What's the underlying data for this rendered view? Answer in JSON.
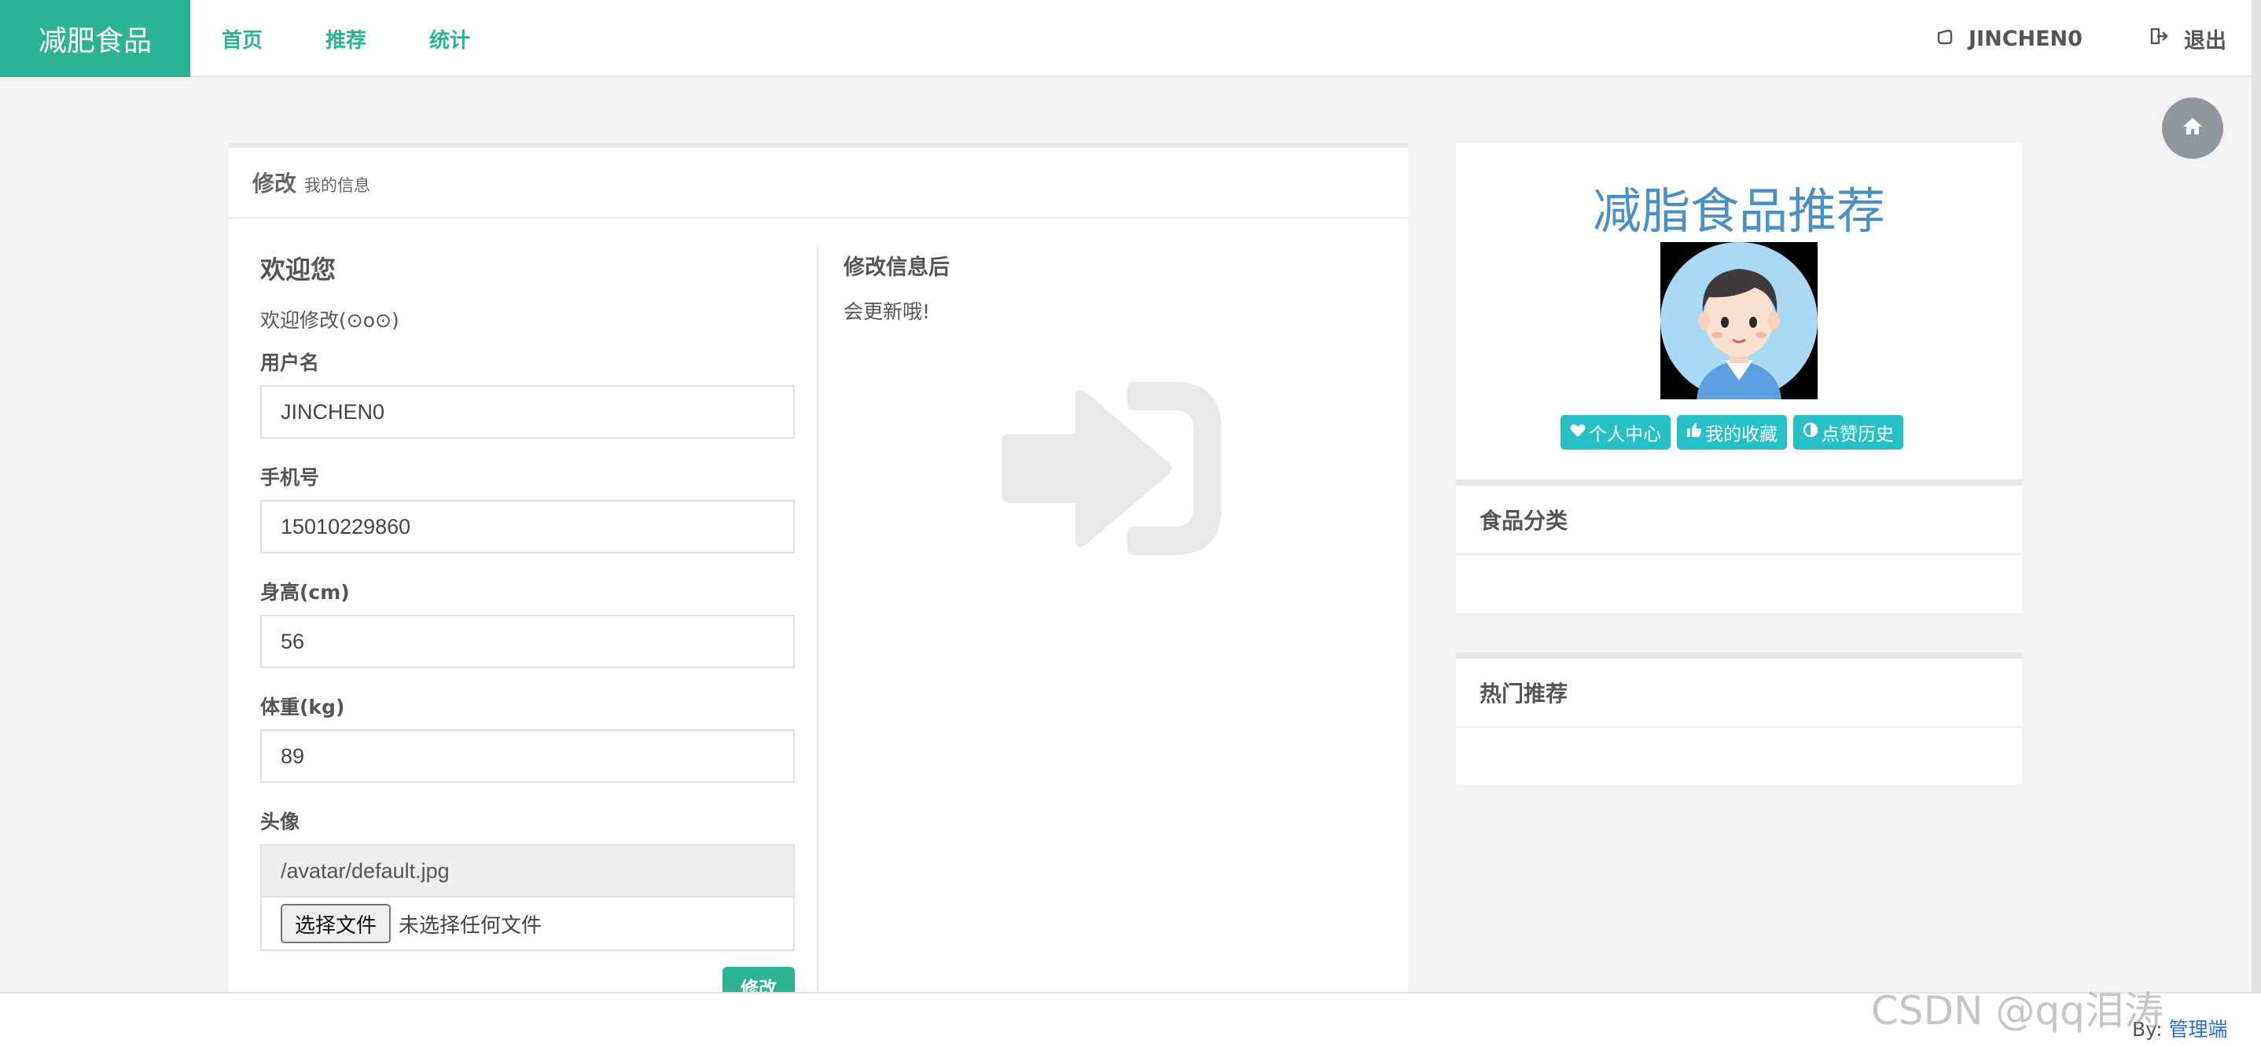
{
  "navbar": {
    "brand": "减肥食品",
    "links": [
      "首页",
      "推荐",
      "统计"
    ],
    "user": "JINCHEN0",
    "logout": "退出"
  },
  "main_card": {
    "title": "修改",
    "subtitle": "我的信息",
    "welcome_heading": "欢迎您",
    "welcome_text": "欢迎修改(⊙o⊙)",
    "fields": {
      "username": {
        "label": "用户名",
        "value": "JINCHEN0"
      },
      "phone": {
        "label": "手机号",
        "value": "15010229860"
      },
      "height": {
        "label": "身高(cm)",
        "value": "56"
      },
      "weight": {
        "label": "体重(kg)",
        "value": "89"
      },
      "avatar": {
        "label": "头像",
        "value": "/avatar/default.jpg"
      }
    },
    "file_button": "选择文件",
    "file_status": "未选择任何文件",
    "submit": "修改",
    "info_title": "修改信息后",
    "info_text": "会更新哦!"
  },
  "sidebar": {
    "profile_title": "减脂食品推荐",
    "pills": [
      {
        "icon": "heart-icon",
        "label": "个人中心"
      },
      {
        "icon": "thumbs-up-icon",
        "label": "我的收藏"
      },
      {
        "icon": "half-circle-icon",
        "label": "点赞历史"
      }
    ],
    "category_title": "食品分类",
    "hot_title": "热门推荐"
  },
  "footer": {
    "by_label": "By:",
    "admin_link": "管理端"
  },
  "watermark": "CSDN @qq泪涛",
  "colors": {
    "brand": "#2bb393",
    "pill": "#26c0c6",
    "title_blue": "#4a90c4"
  }
}
